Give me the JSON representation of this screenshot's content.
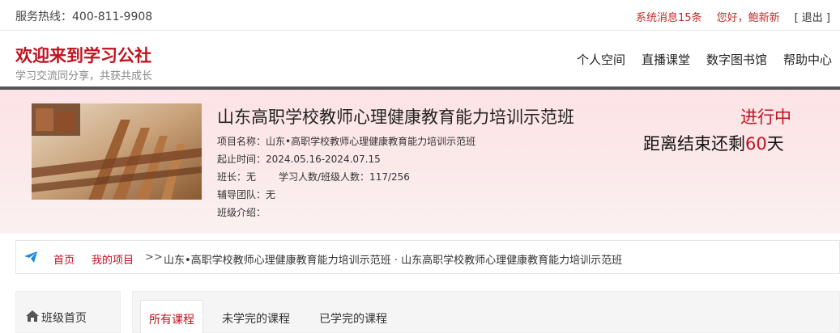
{
  "topbar": {
    "hotline": "服务热线：400-811-9908",
    "messages": "系统消息15条",
    "greeting": "您好，鲍新新",
    "logout": "[ 退出 ]"
  },
  "header": {
    "title": "欢迎来到学习公社",
    "subtitle": "学习交流同分享，共获共成长",
    "nav": [
      "个人空间",
      "直播课堂",
      "数字图书馆",
      "帮助中心"
    ]
  },
  "course": {
    "title": "山东高职学校教师心理健康教育能力培训示范班",
    "project_name": "项目名称：山东•高职学校教师心理健康教育能力培训示范班",
    "dates": "起止时间：2024.05.16-2024.07.15",
    "monitor": "班长：无",
    "learners": "学习人数/班级人数：117/256",
    "tutors": "辅导团队：无",
    "intro": "班级介绍：",
    "status": "进行中",
    "countdown_prefix": "距离结束还剩",
    "countdown_days": "60",
    "countdown_suffix": "天"
  },
  "breadcrumb": {
    "home": "首页",
    "my_projects": "我的项目",
    "separator": ">>",
    "path": "山东•高职学校教师心理健康教育能力培训示范班 · 山东高职学校教师心理健康教育能力培训示范班"
  },
  "sidebar": {
    "item": "班级首页"
  },
  "tabs": [
    "所有课程",
    "未学完的课程",
    "已学完的课程"
  ],
  "colors": {
    "accent": "#c1121f",
    "banner_bg": "#fde3e5",
    "plane_icon": "#1e88e5"
  }
}
